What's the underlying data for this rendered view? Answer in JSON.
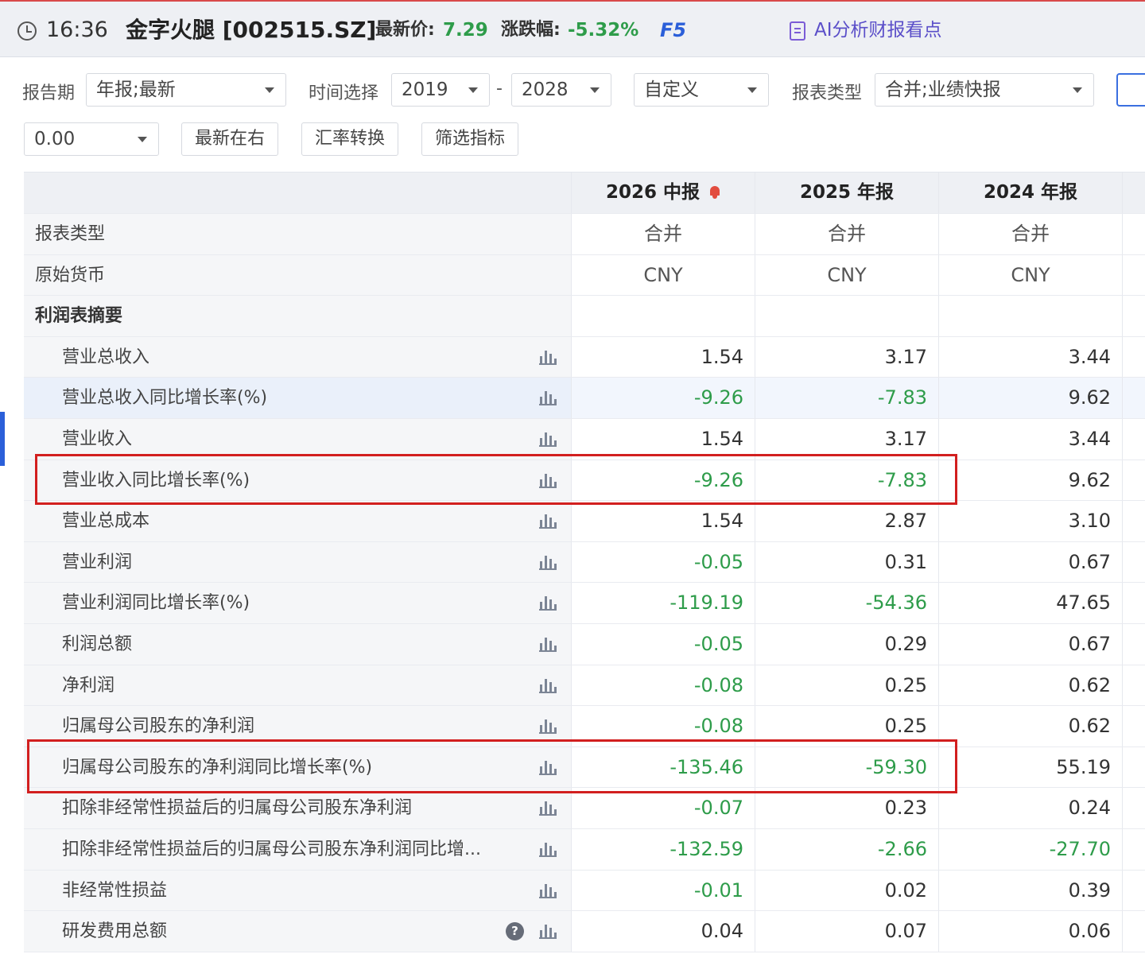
{
  "header": {
    "time": "16:36",
    "stock_name": "金字火腿 [002515.SZ]",
    "price_label": "最新价:",
    "price_value": "7.29",
    "change_label": "涨跌幅:",
    "change_value": "-5.32%",
    "refresh_key": "F5",
    "ai_label": "AI分析财报看点",
    "colors": {
      "down": "#2e9c4a",
      "link": "#2b5fd9",
      "ai": "#5b4fc9"
    }
  },
  "filters": {
    "report_period_label": "报告期",
    "report_period_value": "年报;最新",
    "time_label": "时间选择",
    "year_from": "2019",
    "separator": "-",
    "year_to": "2028",
    "custom_value": "自定义",
    "report_type_label": "报表类型",
    "report_type_value": "合并;业绩快报",
    "precision_value": "0.00",
    "btn_latest_right": "最新在右",
    "btn_fx": "汇率转换",
    "btn_filter": "筛选指标"
  },
  "table": {
    "columns": [
      "2026 中报",
      "2025 年报",
      "2024 年报"
    ],
    "rows": [
      {
        "name": "报表类型",
        "values": [
          "合并",
          "合并",
          "合并"
        ]
      },
      {
        "name": "原始货币",
        "values": [
          "CNY",
          "CNY",
          "CNY"
        ]
      },
      {
        "name": "利润表摘要",
        "values": [
          "",
          "",
          ""
        ]
      },
      {
        "name": "营业总收入",
        "values": [
          "1.54",
          "3.17",
          "3.44"
        ]
      },
      {
        "name": "营业总收入同比增长率(%)",
        "values": [
          "-9.26",
          "-7.83",
          "9.62"
        ]
      },
      {
        "name": "营业收入",
        "values": [
          "1.54",
          "3.17",
          "3.44"
        ]
      },
      {
        "name": "营业收入同比增长率(%)",
        "values": [
          "-9.26",
          "-7.83",
          "9.62"
        ]
      },
      {
        "name": "营业总成本",
        "values": [
          "1.54",
          "2.87",
          "3.10"
        ]
      },
      {
        "name": "营业利润",
        "values": [
          "-0.05",
          "0.31",
          "0.67"
        ]
      },
      {
        "name": "营业利润同比增长率(%)",
        "values": [
          "-119.19",
          "-54.36",
          "47.65"
        ]
      },
      {
        "name": "利润总额",
        "values": [
          "-0.05",
          "0.29",
          "0.67"
        ]
      },
      {
        "name": "净利润",
        "values": [
          "-0.08",
          "0.25",
          "0.62"
        ]
      },
      {
        "name": "归属母公司股东的净利润",
        "values": [
          "-0.08",
          "0.25",
          "0.62"
        ]
      },
      {
        "name": "归属母公司股东的净利润同比增长率(%)",
        "values": [
          "-135.46",
          "-59.30",
          "55.19"
        ]
      },
      {
        "name": "扣除非经常性损益后的归属母公司股东净利润",
        "values": [
          "-0.07",
          "0.23",
          "0.24"
        ]
      },
      {
        "name": "扣除非经常性损益后的归属母公司股东净利润同比增...",
        "values": [
          "-132.59",
          "-2.66",
          "-27.70"
        ]
      },
      {
        "name": "非经常性损益",
        "values": [
          "-0.01",
          "0.02",
          "0.39"
        ]
      },
      {
        "name": "研发费用总额",
        "values": [
          "0.04",
          "0.07",
          "0.06"
        ]
      }
    ]
  }
}
